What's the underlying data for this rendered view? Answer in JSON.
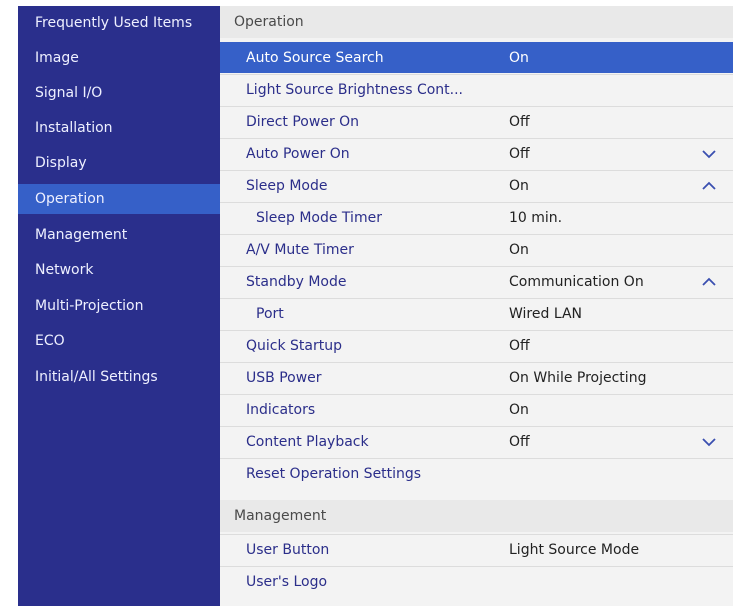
{
  "sidebar": {
    "items": [
      {
        "label": "Frequently Used Items",
        "active": false
      },
      {
        "label": "Image",
        "active": false
      },
      {
        "label": "Signal I/O",
        "active": false
      },
      {
        "label": "Installation",
        "active": false
      },
      {
        "label": "Display",
        "active": false
      },
      {
        "label": "Operation",
        "active": true
      },
      {
        "label": "Management",
        "active": false
      },
      {
        "label": "Network",
        "active": false
      },
      {
        "label": "Multi-Projection",
        "active": false
      },
      {
        "label": "ECO",
        "active": false
      },
      {
        "label": "Initial/All Settings",
        "active": false
      }
    ]
  },
  "main": {
    "operation_header": "Operation",
    "operation_rows": [
      {
        "label": "Auto Source Search",
        "value": "On",
        "selected": true
      },
      {
        "label": "Light Source Brightness Cont...",
        "value": ""
      },
      {
        "label": "Direct Power On",
        "value": "Off"
      },
      {
        "label": "Auto Power On",
        "value": "Off",
        "chevron": "chevron-down-icon"
      },
      {
        "label": "Sleep Mode",
        "value": "On",
        "chevron": "chevron-up-icon"
      },
      {
        "label": "Sleep Mode Timer",
        "value": "10 min.",
        "sub": true
      },
      {
        "label": "A/V Mute Timer",
        "value": "On"
      },
      {
        "label": "Standby Mode",
        "value": "Communication On",
        "chevron": "chevron-up-icon"
      },
      {
        "label": "Port",
        "value": "Wired LAN",
        "sub": true
      },
      {
        "label": "Quick Startup",
        "value": "Off"
      },
      {
        "label": "USB Power",
        "value": "On While Projecting"
      },
      {
        "label": "Indicators",
        "value": "On"
      },
      {
        "label": "Content Playback",
        "value": "Off",
        "chevron": "chevron-down-icon"
      },
      {
        "label": "Reset Operation Settings",
        "value": ""
      }
    ],
    "management_header": "Management",
    "management_rows": [
      {
        "label": "User Button",
        "value": "Light Source Mode"
      },
      {
        "label": "User's Logo",
        "value": ""
      }
    ]
  },
  "colors": {
    "sidebar_bg": "#2a2f8c",
    "accent": "#3660c8",
    "row_text": "#2b2e8a",
    "panel_bg": "#f3f3f3"
  }
}
